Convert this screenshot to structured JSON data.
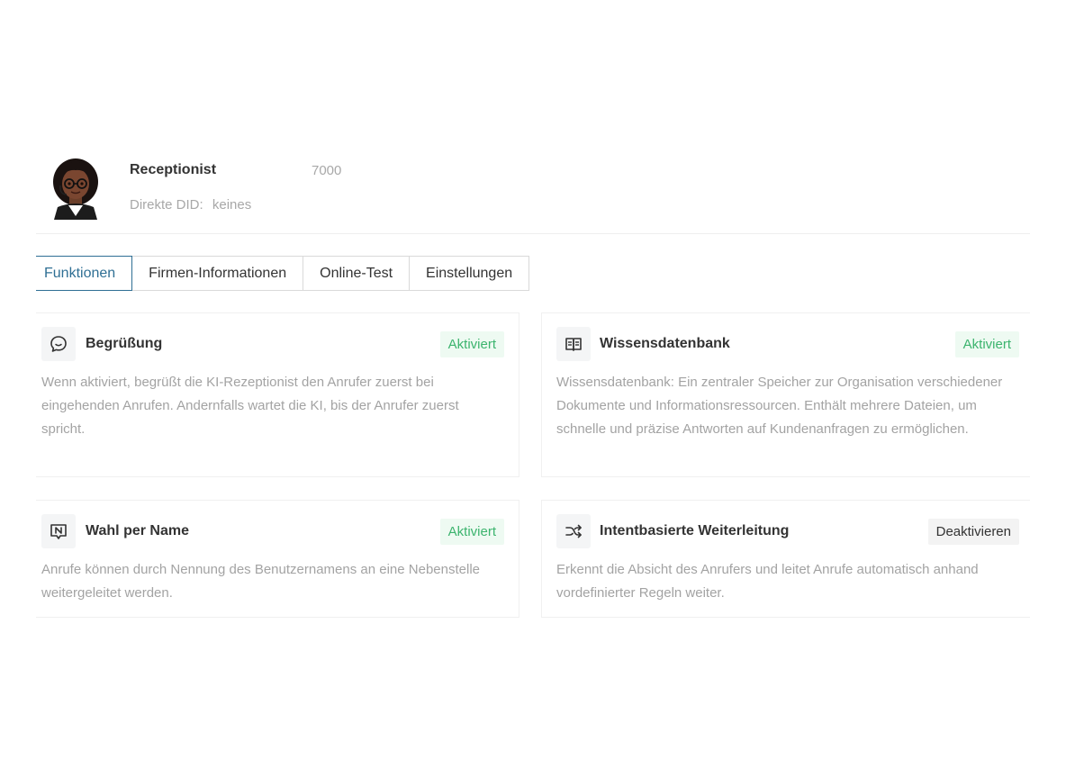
{
  "agent": {
    "name": "Receptionist",
    "extension": "7000",
    "did_label": "Direkte DID:",
    "did_value": "keines"
  },
  "tabs": [
    {
      "label": "Funktionen",
      "active": true
    },
    {
      "label": "Firmen-Informationen",
      "active": false
    },
    {
      "label": "Online-Test",
      "active": false
    },
    {
      "label": "Einstellungen",
      "active": false
    }
  ],
  "features": [
    {
      "icon": "chat-bubble-icon",
      "title": "Begrüßung",
      "status": "Aktiviert",
      "description": "Wenn aktiviert, begrüßt die KI-Rezeptionist den Anrufer zuerst bei eingehenden Anrufen. Andernfalls wartet die KI, bis der Anrufer zuerst spricht."
    },
    {
      "icon": "book-icon",
      "title": "Wissensdatenbank",
      "status": "Aktiviert",
      "description": "Wissensdatenbank: Ein zentraler Speicher zur Organisation verschiedener Dokumente und Informationsressourcen. Enthält mehrere Dateien, um schnelle und präzise Antworten auf Kundenanfragen zu ermöglichen."
    },
    {
      "icon": "name-dial-icon",
      "title": "Wahl per Name",
      "status": "Aktiviert",
      "description": "Anrufe können durch Nennung des Benutzernamens an eine Nebenstelle weitergeleitet werden."
    },
    {
      "icon": "shuffle-icon",
      "title": "Intentbasierte Weiterleitung",
      "status": "Deaktivieren",
      "description": "Erkennt die Absicht des Anrufers und leitet Anrufe automatisch anhand vordefinierter Regeln weiter."
    }
  ],
  "colors": {
    "accent": "#2f6f94",
    "active_badge_text": "#3cb46e",
    "active_badge_bg": "#eefaf2",
    "muted_text": "#a3a3a3"
  }
}
